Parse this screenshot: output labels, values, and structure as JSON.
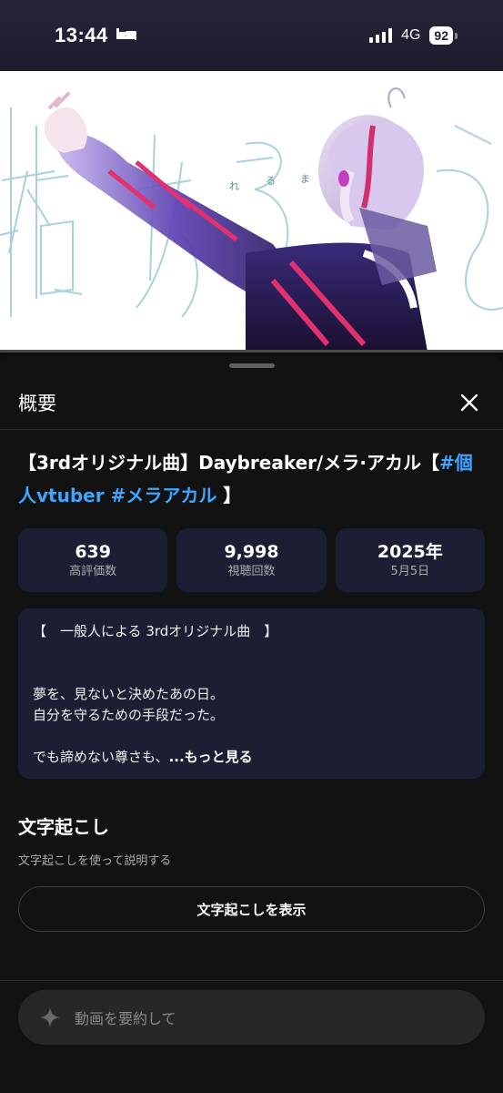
{
  "status_bar": {
    "time": "13:44",
    "network": "4G",
    "battery": "92"
  },
  "sheet": {
    "title": "概要",
    "video_title_prefix": "【3rdオリジナル曲】Daybreaker/メラ·アカル【",
    "hashtag_1": "#個人vtuber",
    "hashtag_2": "#メラアカル",
    "video_title_suffix": "】"
  },
  "stats": [
    {
      "value": "639",
      "label": "高評価数"
    },
    {
      "value": "9,998",
      "label": "視聴回数"
    },
    {
      "value": "2025年",
      "label": "5月5日"
    }
  ],
  "description": {
    "line1": "【　一般人による 3rdオリジナル曲　】",
    "line2": "夢を、見ないと決めたあの日。",
    "line3": "自分を守るための手段だった。",
    "line4": "でも諦めない尊さも、",
    "more": "...もっと見る"
  },
  "transcript": {
    "title": "文字起こし",
    "subtitle": "文字起こしを使って説明する",
    "button": "文字起こしを表示"
  },
  "ask": {
    "placeholder": "動画を要約して"
  },
  "colors": {
    "accent_link": "#3ea6ff",
    "card_bg": "#1c1f33",
    "sheet_bg": "#121212"
  }
}
